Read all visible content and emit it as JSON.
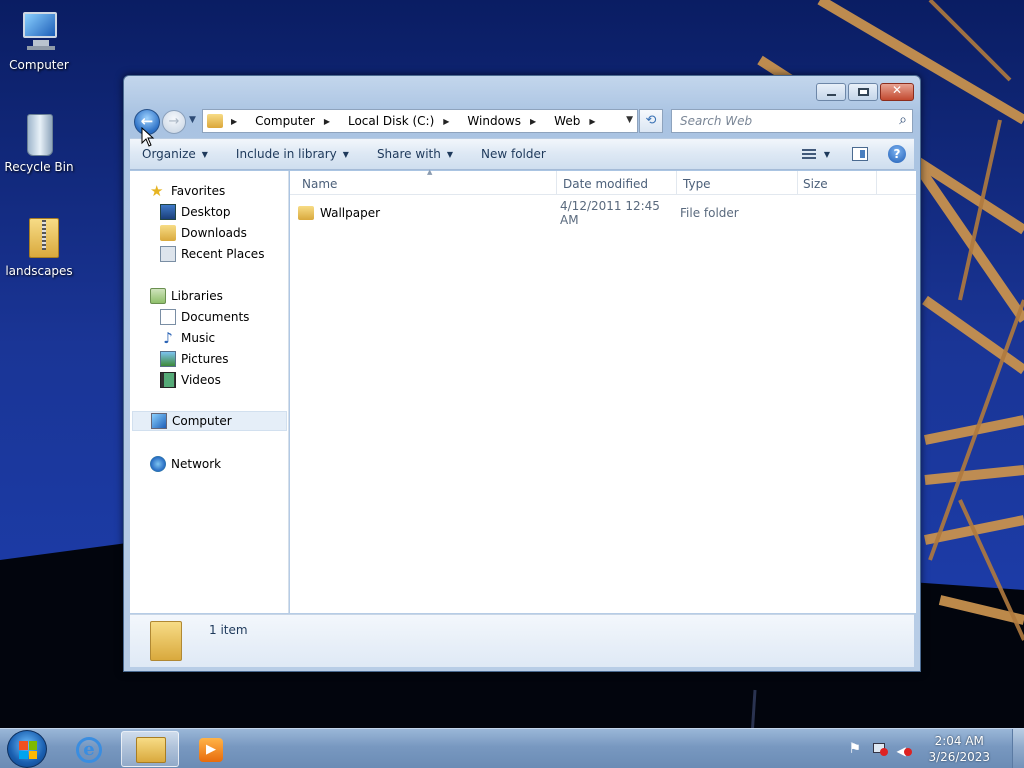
{
  "desktop": {
    "icons": [
      {
        "label": "Computer",
        "icon": "computer-icon"
      },
      {
        "label": "Recycle Bin",
        "icon": "recycle-bin-icon"
      },
      {
        "label": "landscapes",
        "icon": "zip-folder-icon"
      }
    ]
  },
  "window": {
    "breadcrumbs": [
      "Computer",
      "Local Disk (C:)",
      "Windows",
      "Web"
    ],
    "search_placeholder": "Search Web",
    "toolbar": {
      "organize": "Organize",
      "include_in_library": "Include in library",
      "share_with": "Share with",
      "new_folder": "New folder"
    },
    "navigation": {
      "favorites": {
        "label": "Favorites",
        "items": [
          "Desktop",
          "Downloads",
          "Recent Places"
        ]
      },
      "libraries": {
        "label": "Libraries",
        "items": [
          "Documents",
          "Music",
          "Pictures",
          "Videos"
        ]
      },
      "computer": "Computer",
      "network": "Network"
    },
    "columns": [
      "Name",
      "Date modified",
      "Type",
      "Size"
    ],
    "files": [
      {
        "name": "Wallpaper",
        "date_modified": "4/12/2011 12:45 AM",
        "type": "File folder",
        "size": ""
      }
    ],
    "status": {
      "item_count": "1 item"
    }
  },
  "taskbar": {
    "clock_time": "2:04 AM",
    "clock_date": "3/26/2023",
    "pinned": [
      "internet-explorer-icon",
      "windows-explorer-icon",
      "media-player-icon"
    ],
    "tray_icons": [
      "action-center-flag-icon",
      "network-icon",
      "volume-muted-icon"
    ]
  },
  "colors": {
    "accent": "#3b73b5",
    "window_frame": "#b8cde6",
    "taskbar": "#7898c0"
  }
}
